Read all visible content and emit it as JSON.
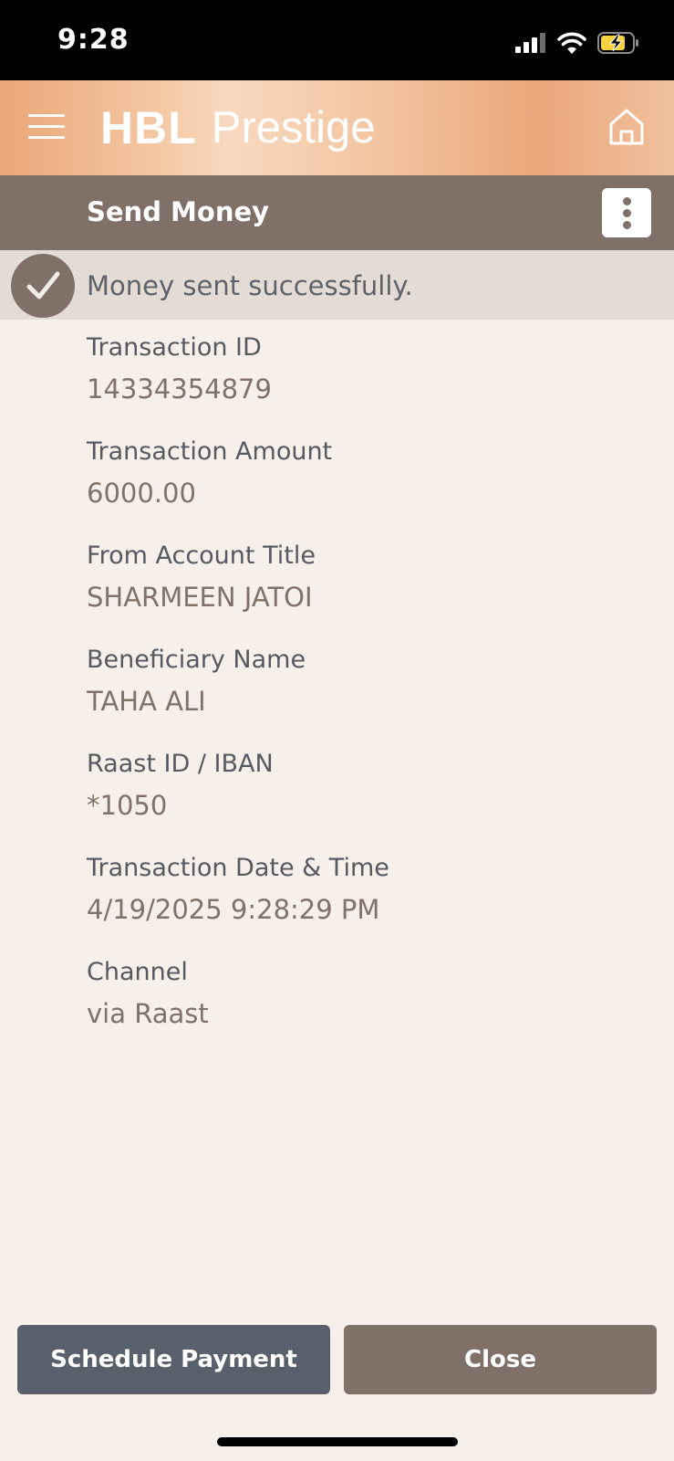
{
  "status_bar": {
    "time": "9:28",
    "icons": [
      "cellular-signal-icon",
      "wifi-icon",
      "battery-charging-icon"
    ],
    "battery_color": "#f7d23e"
  },
  "header": {
    "brand_hbl": "HBL",
    "brand_product": "Prestige",
    "menu_icon": "hamburger-menu-icon",
    "home_icon": "home-icon"
  },
  "sub_header": {
    "title": "Send Money",
    "more_icon": "more-vertical-icon"
  },
  "banner": {
    "icon": "check-circle-icon",
    "message": "Money sent successfully."
  },
  "details": [
    {
      "label": "Transaction ID",
      "value": "14334354879"
    },
    {
      "label": "Transaction Amount",
      "value": "6000.00"
    },
    {
      "label": "From Account Title",
      "value": "SHARMEEN JATOI"
    },
    {
      "label": "Beneficiary Name",
      "value": "TAHA ALI"
    },
    {
      "label": "Raast ID / IBAN",
      "value": "*1050"
    },
    {
      "label": "Transaction Date & Time",
      "value": "4/19/2025 9:28:29 PM"
    },
    {
      "label": "Channel",
      "value": "via Raast"
    }
  ],
  "actions": {
    "schedule_label": "Schedule Payment",
    "close_label": "Close"
  },
  "colors": {
    "background": "#f7efe9",
    "brand_gradient_start": "#eaa778",
    "brand_gradient_mid": "#f8d9c0",
    "taupe": "#7f7068",
    "slate": "#58616b",
    "banner_bg": "#e4dbd4"
  }
}
